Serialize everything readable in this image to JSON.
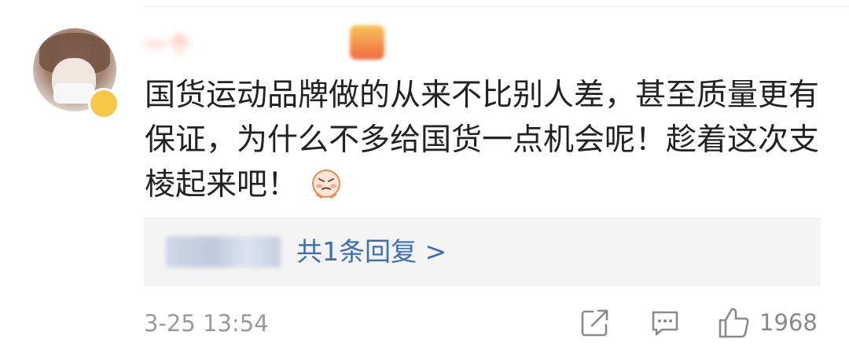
{
  "comment": {
    "username": "一个",
    "text": "国货运动品牌做的从来不比别人差，甚至质量更有保证，为什么不多给国货一点机会呢！趁着这次支棱起来吧！",
    "emoji": "angry-face-emoji"
  },
  "reply": {
    "link_text": "共1条回复 >"
  },
  "meta": {
    "timestamp": "3-25 13:54",
    "like_count": "1968"
  },
  "colors": {
    "link": "#3f6fb0",
    "text": "#222222",
    "muted": "#9a9a9a",
    "reply_bg": "#f4f4f4"
  },
  "icons": [
    "share-icon",
    "comment-icon",
    "thumbs-up-icon"
  ]
}
